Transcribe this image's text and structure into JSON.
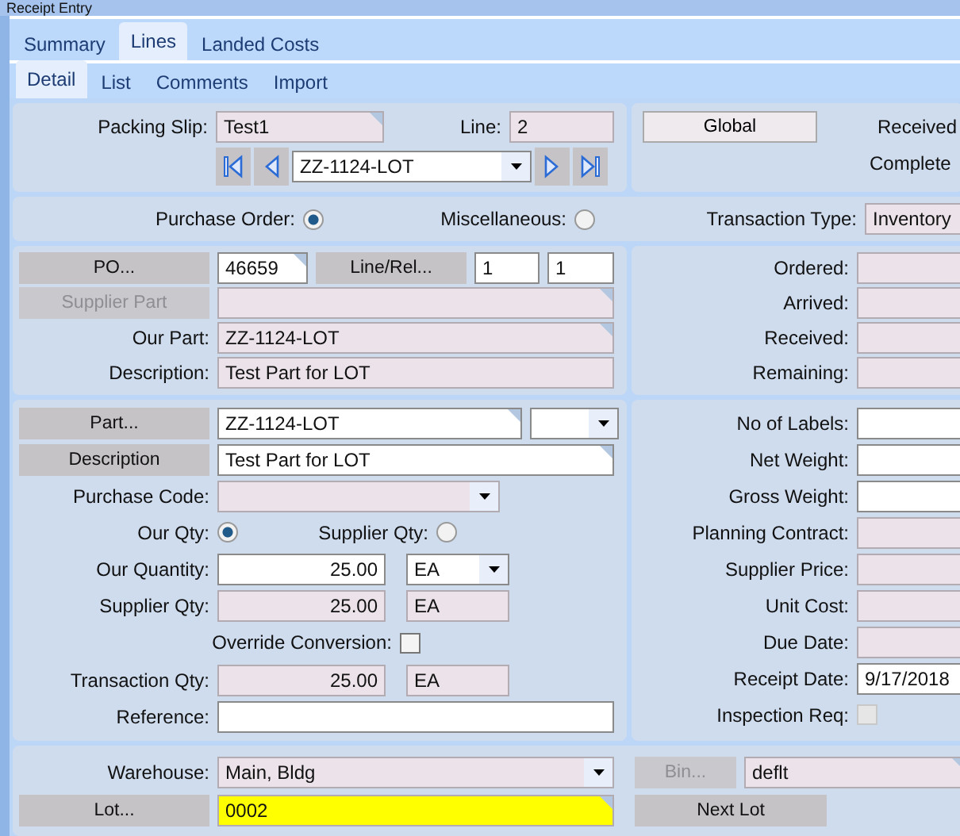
{
  "window": {
    "title": "Receipt Entry"
  },
  "tabs": [
    {
      "label": "Summary",
      "selected": false
    },
    {
      "label": "Lines",
      "selected": true
    },
    {
      "label": "Landed Costs",
      "selected": false
    }
  ],
  "subtabs": [
    {
      "label": "Detail",
      "selected": true
    },
    {
      "label": "List",
      "selected": false
    },
    {
      "label": "Comments",
      "selected": false
    },
    {
      "label": "Import",
      "selected": false
    }
  ],
  "header": {
    "packing_slip": {
      "label": "Packing Slip:",
      "value": "Test1",
      "corner_mark": true
    },
    "line": {
      "label": "Line:",
      "value": "2"
    },
    "line_selector": {
      "value": "ZZ-1124-LOT"
    },
    "global_button": "Global",
    "status_labels": [
      "Received",
      "Complete"
    ]
  },
  "source": {
    "options": [
      {
        "label": "Purchase Order:",
        "selected": true
      },
      {
        "label": "Miscellaneous:",
        "selected": false
      }
    ],
    "transaction_type": {
      "label": "Transaction Type:",
      "value": "Inventory"
    }
  },
  "order": {
    "po_button": "PO...",
    "po": {
      "value": "46659",
      "corner_mark": true
    },
    "line_rel_button": "Line/Rel...",
    "line_rel": [
      "1",
      "1"
    ],
    "supplier_part": {
      "label": "Supplier Part",
      "disabled": true,
      "corner_mark": true
    },
    "our_part": {
      "label": "Our Part:",
      "value": "ZZ-1124-LOT",
      "corner_mark": true
    },
    "description": {
      "label": "Description:",
      "value": "Test Part for LOT"
    },
    "totals": [
      {
        "label": "Ordered:"
      },
      {
        "label": "Arrived:"
      },
      {
        "label": "Received:"
      },
      {
        "label": "Remaining:"
      }
    ]
  },
  "part": {
    "part_button": "Part...",
    "part": {
      "value": "ZZ-1124-LOT",
      "corner_mark": true
    },
    "description_button": "Description",
    "description": {
      "value": "Test Part for LOT",
      "corner_mark": true
    },
    "purchase_code": {
      "label": "Purchase Code:"
    },
    "qty_basis": [
      {
        "label": "Our Qty:",
        "selected": true
      },
      {
        "label": "Supplier Qty:",
        "selected": false
      }
    ],
    "quantities": [
      {
        "label": "Our Quantity:",
        "value": "25.00",
        "uom": "EA",
        "editable": true
      },
      {
        "label": "Supplier Qty:",
        "value": "25.00",
        "uom": "EA",
        "editable": false
      }
    ],
    "override_conversion": {
      "label": "Override Conversion:",
      "checked": false,
      "disabled": false
    },
    "transaction_qty": {
      "label": "Transaction Qty:",
      "value": "25.00",
      "uom": "EA"
    },
    "reference": {
      "label": "Reference:"
    },
    "details": [
      {
        "kind": "field",
        "label": "No of Labels:",
        "editable": true
      },
      {
        "kind": "field",
        "label": "Net Weight:",
        "editable": true
      },
      {
        "kind": "field",
        "label": "Gross Weight:",
        "editable": true
      },
      {
        "kind": "field",
        "label": "Planning Contract:",
        "editable": false
      },
      {
        "kind": "field",
        "label": "Supplier Price:",
        "editable": false
      },
      {
        "kind": "field",
        "label": "Unit Cost:",
        "editable": false
      },
      {
        "kind": "field",
        "label": "Due Date:",
        "editable": false
      },
      {
        "kind": "field",
        "label": "Receipt Date:",
        "editable": true,
        "value": "9/17/2018"
      },
      {
        "kind": "checkbox",
        "label": "Inspection Req:",
        "checked": false,
        "disabled": true
      }
    ]
  },
  "location": {
    "warehouse": {
      "label": "Warehouse:",
      "value": "Main, Bldg"
    },
    "bin_button": {
      "label": "Bin...",
      "disabled": true
    },
    "bin": {
      "value": "deflt",
      "corner_mark": true
    },
    "lot_button": "Lot...",
    "lot": {
      "value": "0002",
      "highlighted": true,
      "corner_mark": true
    },
    "next_lot_button": "Next Lot"
  }
}
